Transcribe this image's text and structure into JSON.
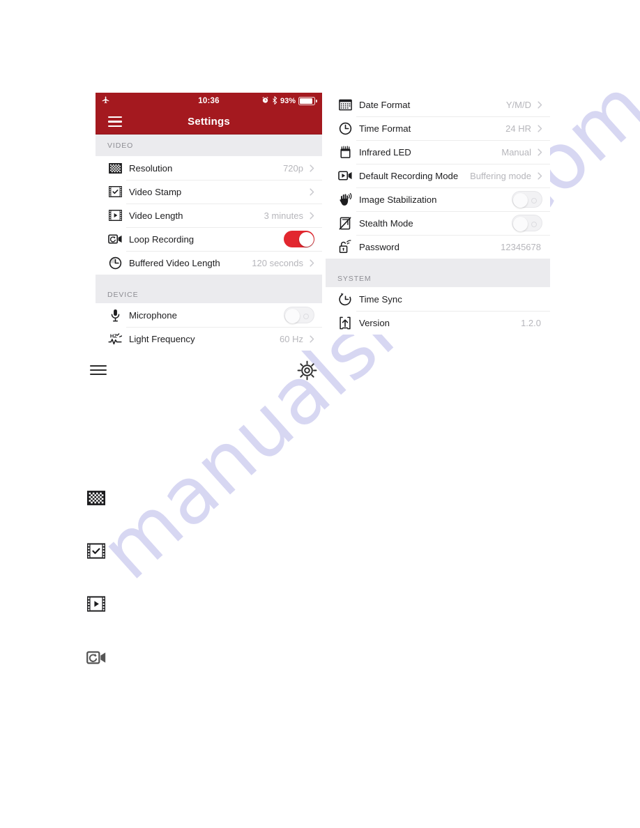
{
  "watermark": {
    "text": "manualshive.com"
  },
  "phone": {
    "status_bar": {
      "airplane_icon": "airplane-icon",
      "time": "10:36",
      "alarm_icon": "alarm-icon",
      "bluetooth_icon": "bluetooth-icon",
      "battery_percent": "93%",
      "battery_icon": "battery-icon"
    },
    "nav": {
      "menu_icon": "hamburger-menu-icon",
      "title": "Settings"
    },
    "accent_color": "#A4191F",
    "toggle_on_color": "#E2272F",
    "sections": [
      {
        "id": "video",
        "header": "VIDEO",
        "rows": [
          {
            "icon": "checkerboard-icon",
            "label": "Resolution",
            "value": "720p",
            "control": "chevron"
          },
          {
            "icon": "film-check-icon",
            "label": "Video Stamp",
            "value": "",
            "control": "chevron"
          },
          {
            "icon": "film-play-icon",
            "label": "Video Length",
            "value": "3 minutes",
            "control": "chevron"
          },
          {
            "icon": "camera-loop-icon",
            "label": "Loop Recording",
            "value": "",
            "control": "toggle-on"
          },
          {
            "icon": "clock-buffer-icon",
            "label": "Buffered Video Length",
            "value": "120 seconds",
            "control": "chevron"
          }
        ]
      },
      {
        "id": "device",
        "header": "DEVICE",
        "rows": [
          {
            "icon": "microphone-icon",
            "label": "Microphone",
            "value": "",
            "control": "toggle-off"
          },
          {
            "icon": "light-frequency-icon",
            "label": "Light Frequency",
            "value": "60 Hz",
            "control": "chevron"
          }
        ]
      },
      {
        "id": "display",
        "header": "",
        "rows": [
          {
            "icon": "calendar-icon",
            "label": "Date Format",
            "value": "Y/M/D",
            "control": "chevron"
          },
          {
            "icon": "clock-icon",
            "label": "Time Format",
            "value": "24 HR",
            "control": "chevron"
          },
          {
            "icon": "infrared-led-icon",
            "label": "Infrared LED",
            "value": "Manual",
            "control": "chevron"
          },
          {
            "icon": "video-mode-icon",
            "label": "Default Recording Mode",
            "value": "Buffering mode",
            "control": "chevron"
          },
          {
            "icon": "hand-shake-icon",
            "label": "Image Stabilization",
            "value": "",
            "control": "toggle-off"
          },
          {
            "icon": "stealth-icon",
            "label": "Stealth Mode",
            "value": "",
            "control": "toggle-off"
          },
          {
            "icon": "wifi-lock-icon",
            "label": "Password",
            "value": "12345678",
            "control": "none"
          }
        ]
      },
      {
        "id": "system",
        "header": "SYSTEM",
        "rows": [
          {
            "icon": "time-sync-icon",
            "label": "Time Sync",
            "value": "",
            "control": "none"
          },
          {
            "icon": "version-icon",
            "label": "Version",
            "value": "1.2.0",
            "control": "none"
          }
        ]
      }
    ]
  },
  "callouts": [
    {
      "icon": "hamburger-menu-icon",
      "name": "menu-callout-icon"
    },
    {
      "icon": "gear-icon",
      "name": "settings-gear-callout-icon"
    },
    {
      "icon": "checkerboard-icon",
      "name": "resolution-callout-icon"
    },
    {
      "icon": "film-check-icon",
      "name": "video-stamp-callout-icon"
    },
    {
      "icon": "film-play-icon",
      "name": "video-length-callout-icon"
    },
    {
      "icon": "camera-loop-icon",
      "name": "loop-recording-callout-icon"
    }
  ]
}
